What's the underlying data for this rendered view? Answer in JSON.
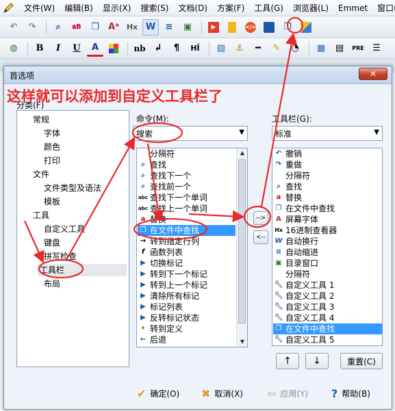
{
  "menu": {
    "items": [
      "文件(W)",
      "编辑(B)",
      "显示(X)",
      "搜索(S)",
      "文档(D)",
      "方案(F)",
      "工具(G)",
      "浏览器(L)",
      "Emmet",
      "窗口(K)"
    ]
  },
  "toolbar2_labels": {
    "bold": "B",
    "italic": "I",
    "underline": "U",
    "font": "A",
    "nb": "nb",
    "hr": "HĪ",
    "pre": "PRE"
  },
  "dialog": {
    "title": "首选项",
    "close": "✕",
    "category_label": "分类(F)",
    "categories": [
      "常规",
      "字体",
      "颜色",
      "打印",
      "文件",
      "文件类型及语法",
      "模板",
      "工具",
      "自定义工具",
      "键盘",
      "拼写检查",
      "工具栏",
      "布局"
    ],
    "command_label": "命令(M):",
    "command_combo": "搜索",
    "commands": [
      "分隔符",
      "查找",
      "查找下一个",
      "查找前一个",
      "查找下一个单词",
      "查找上一个单词",
      "替换",
      "在文件中查找",
      "转到指定行列",
      "函数列表",
      "切换标记",
      "转到下一个标记",
      "转到上一个标记",
      "清除所有标记",
      "标记列表",
      "反转标记状态",
      "转到定义",
      "后退"
    ],
    "toolbar_label": "工具栏(G):",
    "toolbar_combo": "标准",
    "toolbar_items": [
      "撤销",
      "重做",
      "分隔符",
      "查找",
      "替换",
      "在文件中查找",
      "屏幕字体",
      "16进制查看器",
      "自动换行",
      "自动缩进",
      "目录窗口",
      "分隔符",
      "自定义工具  1",
      "自定义工具  2",
      "自定义工具  3",
      "自定义工具  4",
      "在文件中查找",
      "自定义工具  5"
    ],
    "add_button": "-->",
    "remove_button": "<--",
    "up_button": "↑",
    "down_button": "↓",
    "reset_button": "重置(C)",
    "ok": "确定(O)",
    "cancel": "取消(X)",
    "apply": "应用(Y)",
    "help": "帮助(B)"
  },
  "annotation": "这样就可以添加到自定义工具栏了",
  "colors": {
    "annotation": "#e8292a",
    "selection": "#3399ff",
    "close": "#c5432a"
  }
}
